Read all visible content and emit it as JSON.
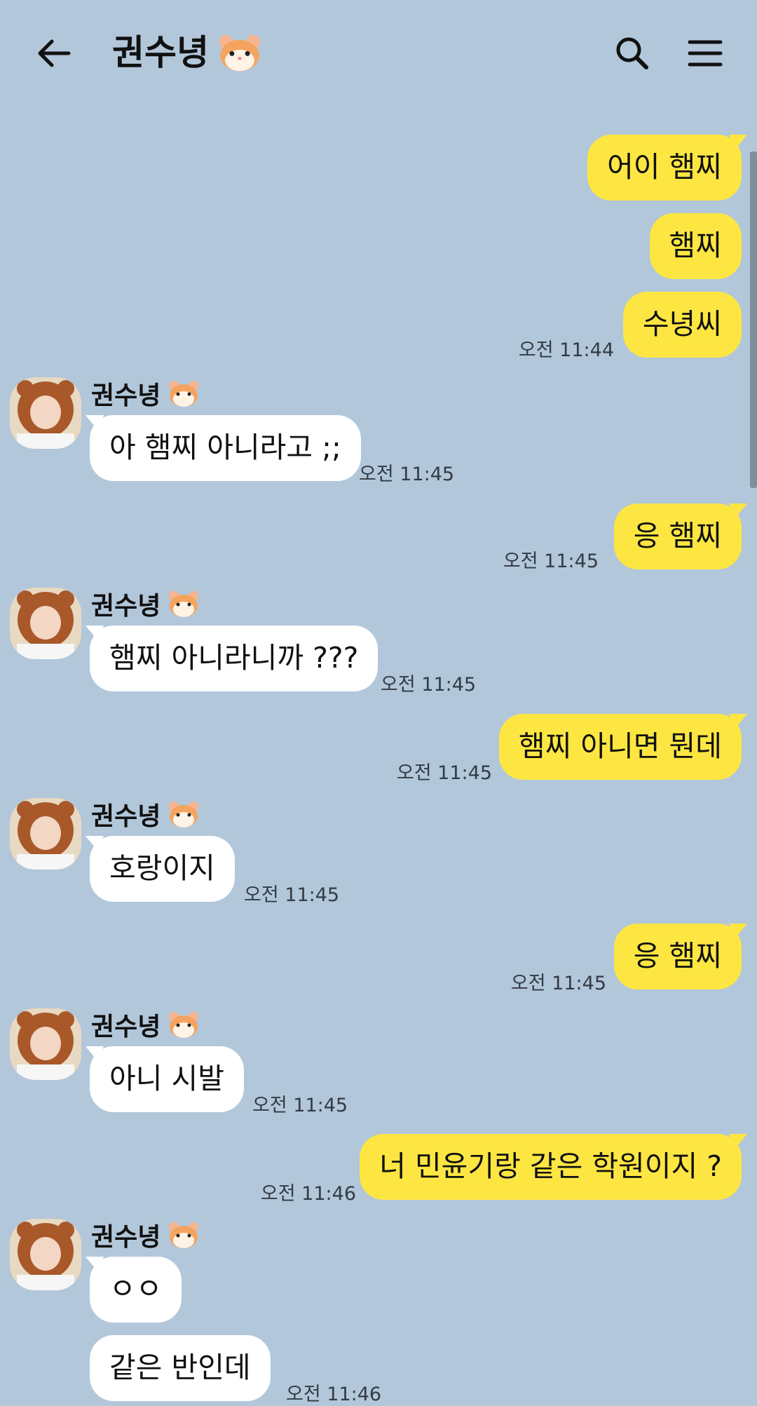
{
  "header": {
    "title": "권수녕",
    "title_emoji_icon": "hamster-icon",
    "back_icon": "back-arrow-icon",
    "search_icon": "search-icon",
    "menu_icon": "menu-icon"
  },
  "contact_name": "권수녕",
  "colors": {
    "background": "#b2c7da",
    "mine_bubble": "#fde642",
    "their_bubble": "#ffffff"
  },
  "messages": [
    {
      "from": "me",
      "text": "어이 햄찌",
      "time": ""
    },
    {
      "from": "me",
      "text": "햄찌",
      "time": ""
    },
    {
      "from": "me",
      "text": "수녕씨",
      "time": "오전 11:44"
    },
    {
      "from": "them",
      "text": "아 햄찌 아니라고 ;;",
      "time": "오전 11:45"
    },
    {
      "from": "me",
      "text": "응 햄찌",
      "time": "오전 11:45"
    },
    {
      "from": "them",
      "text": "햄찌 아니라니까 ???",
      "time": "오전 11:45"
    },
    {
      "from": "me",
      "text": "햄찌 아니면 뭔데",
      "time": "오전 11:45"
    },
    {
      "from": "them",
      "text": "호랑이지",
      "time": "오전 11:45"
    },
    {
      "from": "me",
      "text": "응 햄찌",
      "time": "오전 11:45"
    },
    {
      "from": "them",
      "text": "아니 시발",
      "time": "오전 11:45"
    },
    {
      "from": "me",
      "text": "너 민윤기랑 같은 학원이지 ?",
      "time": "오전 11:46"
    },
    {
      "from": "them",
      "text": "ㅇㅇ",
      "time": ""
    },
    {
      "from": "them",
      "text": "같은 반인데",
      "time": "오전 11:46"
    }
  ]
}
